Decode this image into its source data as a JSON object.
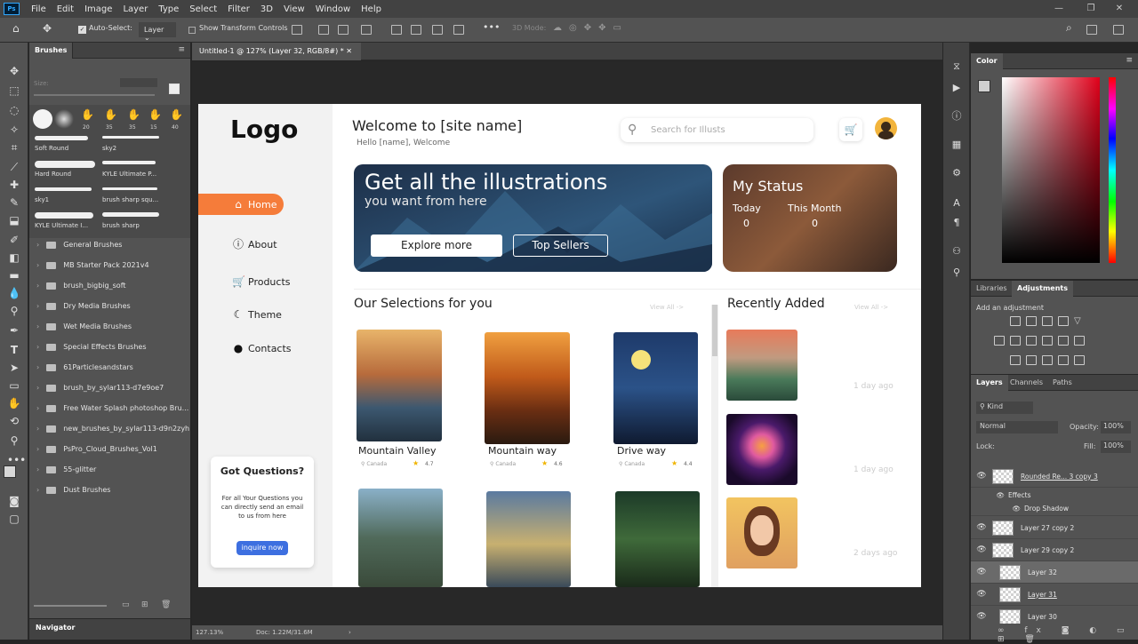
{
  "menu": [
    "File",
    "Edit",
    "Image",
    "Layer",
    "Type",
    "Select",
    "Filter",
    "3D",
    "View",
    "Window",
    "Help"
  ],
  "app_icon": "Ps",
  "options": {
    "auto_select": "Auto-Select:",
    "target": "Layer",
    "transform": "Show Transform Controls",
    "mode3d": "3D Mode:"
  },
  "brushes_panel": {
    "tab": "Brushes",
    "size_label": "Size:",
    "presets": [
      "20",
      "35",
      "35",
      "15",
      "40"
    ],
    "items": [
      "Soft Round",
      "sky2",
      "Hard Round",
      "KYLE Ultimate P...",
      "sky1",
      "brush sharp squ...",
      "KYLE Ultimate I...",
      "brush sharp"
    ],
    "folders": [
      "General Brushes",
      "MB Starter Pack 2021v4",
      "brush_bigbig_soft",
      "Dry Media Brushes",
      "Wet Media Brushes",
      "Special Effects Brushes",
      "61Particlesandstars",
      "brush_by_sylar113-d7e9oe7",
      "Free Water Splash photoshop Bru...",
      "new_brushes_by_sylar113-d9n2zyh",
      "PsPro_Cloud_Brushes_Vol1",
      "55-glitter",
      "Dust Brushes"
    ]
  },
  "navigator": "Navigator",
  "document": {
    "tab": "Untitled-1 @ 127% (Layer 32, RGB/8#) *",
    "zoom": "127.13%",
    "doc": "Doc: 1.22M/31.6M"
  },
  "site": {
    "logo": "Logo",
    "nav": [
      "Home",
      "About",
      "Products",
      "Theme",
      "Contacts"
    ],
    "welcome": "Welcome to [site name]",
    "hello": "Hello [name], Welcome",
    "search_placeholder": "Search for Illusts",
    "hero_title": "Get all the illustrations",
    "hero_sub": "you want from here",
    "explore": "Explore more",
    "top_sellers": "Top Sellers",
    "status_title": "My Status",
    "today": "Today",
    "today_val": "0",
    "month": "This Month",
    "month_val": "0",
    "selections": "Our Selections for you",
    "view_all": "View All ->",
    "recent": "Recently Added",
    "cards": [
      {
        "title": "Mountain Valley",
        "loc": "Canada",
        "rating": "4.7"
      },
      {
        "title": "Mountain way",
        "loc": "Canada",
        "rating": "4.6"
      },
      {
        "title": "Drive way",
        "loc": "Canada",
        "rating": "4.4"
      }
    ],
    "recent_times": [
      "1 day ago",
      "1 day ago",
      "2 days ago"
    ],
    "q_title": "Got Questions?",
    "q_body": "For all Your Questions you can directly send an email to us from here",
    "q_btn": "inquire now"
  },
  "color_panel": "Color",
  "adj": {
    "tabs": [
      "Libraries",
      "Adjustments"
    ],
    "label": "Add an adjustment"
  },
  "layers": {
    "tabs": [
      "Layers",
      "Channels",
      "Paths"
    ],
    "kind": "Kind",
    "blend": "Normal",
    "opacity_label": "Opacity:",
    "opacity": "100%",
    "lock": "Lock:",
    "fill_label": "Fill:",
    "fill": "100%",
    "rows": [
      "Rounded Re... 3 copy 3",
      "Effects",
      "Drop Shadow",
      "Layer 27 copy 2",
      "Layer 29 copy 2",
      "Layer 32",
      "Layer 31",
      "Layer 30"
    ]
  },
  "colors": {
    "accent": "#f57c3a",
    "navy": "#1f3a5c",
    "inquire": "#3d6fe0",
    "ps_blue": "#31a8ff"
  }
}
